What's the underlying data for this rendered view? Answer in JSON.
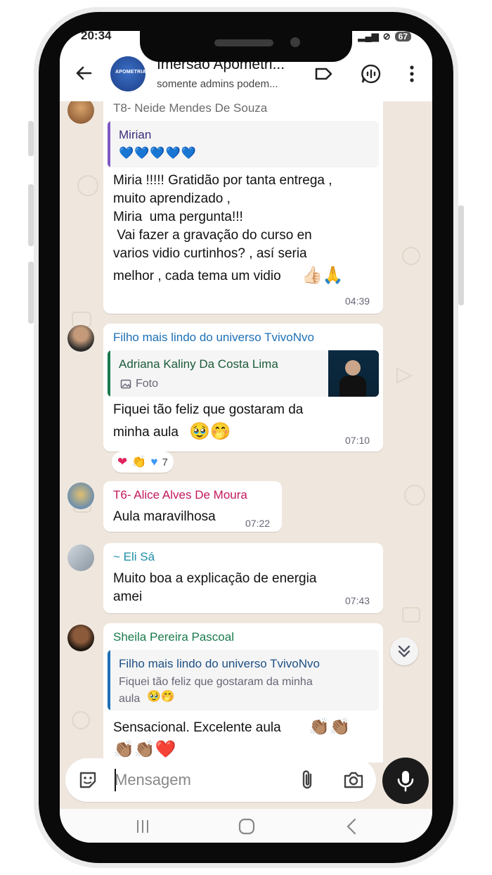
{
  "status": {
    "time": "20:34",
    "battery": "67"
  },
  "header": {
    "title": "Imersão Apometri...",
    "subtitle": "somente admins podem..."
  },
  "messages": [
    {
      "sender": "T8- Neide Mendes De Souza",
      "quote_author": "Mirian",
      "quote_text": "💙💙💙💙💙",
      "lines": [
        "Miria !!!!! Gratidão por tanta entrega ,",
        "muito aprendizado ,",
        "Miria  uma pergunta!!!",
        " Vai fazer a gravação do curso en",
        "varios vidio curtinhos? , así seria",
        "melhor , cada tema um vidio"
      ],
      "time": "04:39"
    },
    {
      "sender": "Filho mais lindo do universo TvivoNvo",
      "quote_author": "Adriana Kaliny Da Costa Lima",
      "quote_text": "Foto",
      "lines": [
        "Fiquei tão feliz que gostaram da",
        "minha aula"
      ],
      "time": "07:10",
      "reaction_count": "7"
    },
    {
      "sender": "T6- Alice Alves De Moura",
      "text": "Aula maravilhosa",
      "time": "07:22"
    },
    {
      "sender": "~ Eli Sá",
      "lines": [
        "Muito boa a explicação de energia",
        "amei"
      ],
      "time": "07:43"
    },
    {
      "sender": "Sheila Pereira Pascoal",
      "quote_author": "Filho mais lindo do universo TvivoNvo",
      "quote_lines": [
        "Fiquei tão feliz que gostaram da minha",
        "aula"
      ],
      "text": "Sensacional. Excelente aula"
    }
  ],
  "input": {
    "placeholder": "Mensagem"
  },
  "colors": {
    "sender_neide": "#6b6b6b",
    "sender_filho": "#1c6fb5",
    "sender_alice": "#c2185b",
    "sender_eli": "#1f8ea8",
    "sender_sheila": "#1a7a4c",
    "quote_mirian_bar": "#7e57c2",
    "quote_adriana_bar": "#1a7a4c",
    "quote_filho_bar": "#1c6fb5"
  }
}
